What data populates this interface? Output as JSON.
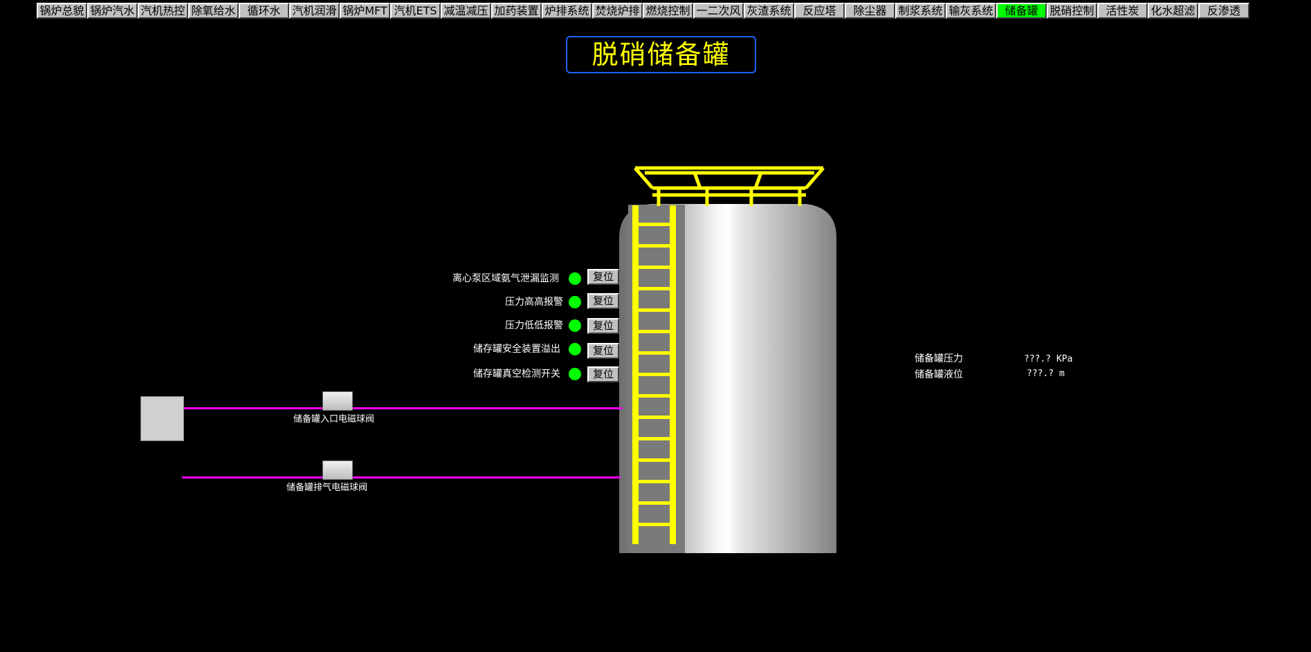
{
  "nav": {
    "tabs": [
      {
        "label": "锅炉总貌"
      },
      {
        "label": "锅炉汽水"
      },
      {
        "label": "汽机热控"
      },
      {
        "label": "除氧给水"
      },
      {
        "label": "循环水"
      },
      {
        "label": "汽机润滑"
      },
      {
        "label": "锅炉MFT"
      },
      {
        "label": "汽机ETS"
      },
      {
        "label": "减温减压"
      },
      {
        "label": "加药装置"
      },
      {
        "label": "炉排系统"
      },
      {
        "label": "焚烧炉排"
      },
      {
        "label": "燃烧控制"
      },
      {
        "label": "一二次风"
      },
      {
        "label": "灰渣系统"
      },
      {
        "label": "反应塔"
      },
      {
        "label": "除尘器"
      },
      {
        "label": "制浆系统"
      },
      {
        "label": "输灰系统"
      },
      {
        "label": "储备罐"
      },
      {
        "label": "脱硝控制"
      },
      {
        "label": "活性炭"
      },
      {
        "label": "化水超滤"
      },
      {
        "label": "反渗透"
      }
    ],
    "active_tab": "储备罐",
    "active_color": "#00ff00"
  },
  "page": {
    "title": "脱硝储备罐",
    "title_color": "#ffff00",
    "title_border_color": "#1e64ff"
  },
  "alarms": [
    {
      "label": "离心泵区域氨气泄漏监测",
      "status": "normal",
      "reset_label": "复位"
    },
    {
      "label": "压力高高报警",
      "status": "normal",
      "reset_label": "复位"
    },
    {
      "label": "压力低低报警",
      "status": "normal",
      "reset_label": "复位"
    },
    {
      "label": "储存罐安全装置溢出",
      "status": "normal",
      "reset_label": "复位"
    },
    {
      "label": "储存罐真空检测开关",
      "status": "normal",
      "reset_label": "复位"
    }
  ],
  "status_colors": {
    "normal": "#00ff00"
  },
  "valves": {
    "inlet": {
      "label": "储备罐入口电磁球阀"
    },
    "vent": {
      "label": "储备罐排气电磁球阀"
    }
  },
  "pipe_color": "#ff00ff",
  "readings": {
    "pressure": {
      "label": "储备罐压力",
      "value": "???.? KPa"
    },
    "level": {
      "label": "储备罐液位",
      "value": "???.? m"
    }
  },
  "icons": {
    "tank": "storage-tank-icon",
    "ladder": "ladder-icon",
    "railing": "railing-icon",
    "valve": "solenoid-valve-icon",
    "led": "status-led-icon"
  }
}
